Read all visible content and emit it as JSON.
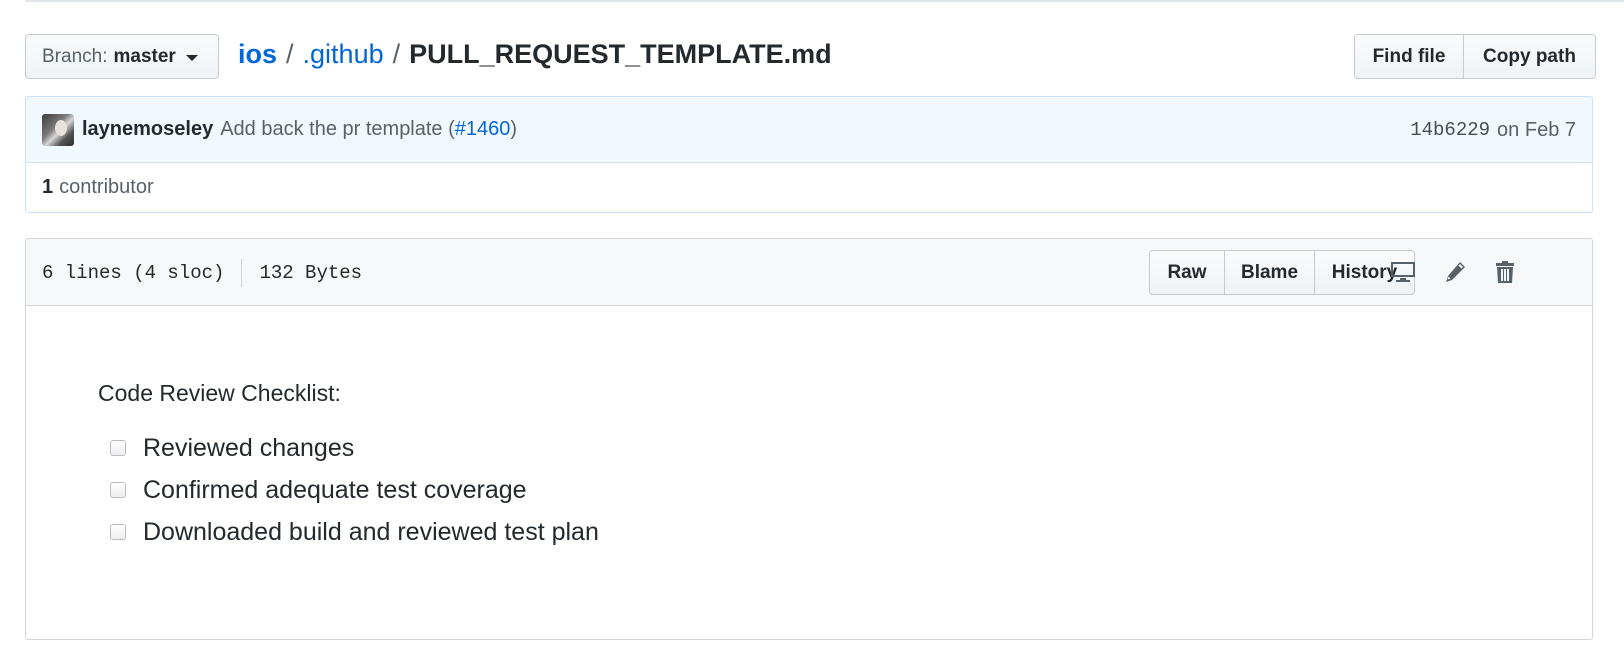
{
  "branch": {
    "label": "Branch:",
    "value": "master"
  },
  "breadcrumb": {
    "root": "ios",
    "separator": "/",
    "folder": ".github",
    "file": "PULL_REQUEST_TEMPLATE.md"
  },
  "file_nav": {
    "find_file": "Find file",
    "copy_path": "Copy path"
  },
  "commit": {
    "author": "laynemoseley",
    "message_prefix": "Add back the pr template (",
    "issue": "#1460",
    "message_suffix": ")",
    "sha": "14b6229",
    "date": "on Feb 7"
  },
  "contributors": {
    "count": "1",
    "label": "contributor"
  },
  "file": {
    "lines": "6 lines (4 sloc)",
    "size": "132 Bytes",
    "actions": {
      "raw": "Raw",
      "blame": "Blame",
      "history": "History"
    },
    "icons": [
      "desktop-icon",
      "pencil-icon",
      "trashcan-icon"
    ]
  },
  "content": {
    "title": "Code Review Checklist:",
    "tasks": [
      {
        "label": "Reviewed changes",
        "checked": false
      },
      {
        "label": "Confirmed adequate test coverage",
        "checked": false
      },
      {
        "label": "Downloaded build and reviewed test plan",
        "checked": false
      }
    ]
  },
  "colors": {
    "link": "#0366d6",
    "commit_bg": "#f1f8ff",
    "commit_border": "#c8e1ff",
    "header_bg": "#f6f8fa",
    "border": "#d1d5da"
  }
}
